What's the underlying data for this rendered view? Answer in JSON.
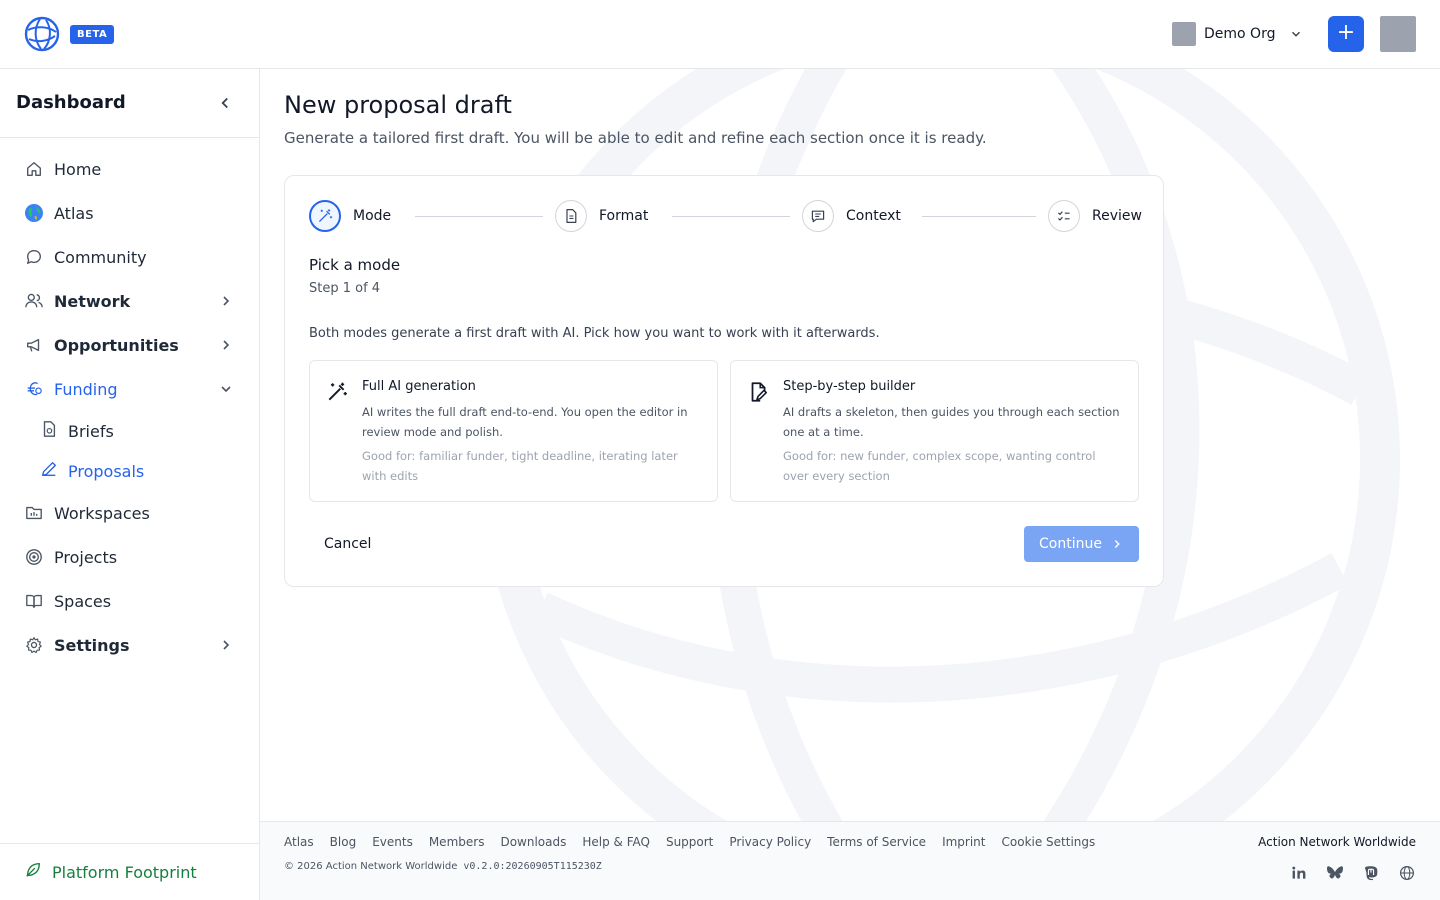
{
  "header": {
    "badge": "BETA",
    "org_name": "Demo Org",
    "add_label": "+"
  },
  "sidebar": {
    "title": "Dashboard",
    "items": [
      {
        "label": "Home"
      },
      {
        "label": "Atlas"
      },
      {
        "label": "Community"
      },
      {
        "label": "Network"
      },
      {
        "label": "Opportunities"
      },
      {
        "label": "Funding"
      },
      {
        "label": "Workspaces"
      },
      {
        "label": "Projects"
      },
      {
        "label": "Spaces"
      },
      {
        "label": "Settings"
      }
    ],
    "funding_children": [
      {
        "label": "Briefs"
      },
      {
        "label": "Proposals"
      }
    ],
    "footer_label": "Platform Footprint"
  },
  "main": {
    "title": "New proposal draft",
    "subtitle": "Generate a tailored first draft. You will be able to edit and refine each section once it is ready.",
    "steps": [
      {
        "label": "Mode"
      },
      {
        "label": "Format"
      },
      {
        "label": "Context"
      },
      {
        "label": "Review"
      }
    ],
    "section_title": "Pick a mode",
    "section_step": "Step 1 of 4",
    "section_desc": "Both modes generate a first draft with AI. Pick how you want to work with it afterwards.",
    "options": [
      {
        "title": "Full AI generation",
        "desc": "AI writes the full draft end-to-end. You open the editor in review mode and polish.",
        "good_label": "Good for:",
        "good_text": "familiar funder, tight deadline, iterating later with edits"
      },
      {
        "title": "Step-by-step builder",
        "desc": "AI drafts a skeleton, then guides you through each section one at a time.",
        "good_label": "Good for:",
        "good_text": "new funder, complex scope, wanting control over every section"
      }
    ],
    "cancel_label": "Cancel",
    "continue_label": "Continue"
  },
  "footer": {
    "links": [
      "Atlas",
      "Blog",
      "Events",
      "Members",
      "Downloads",
      "Help & FAQ",
      "Support",
      "Privacy Policy",
      "Terms of Service",
      "Imprint",
      "Cookie Settings"
    ],
    "copyright": "© 2026 Action Network Worldwide",
    "version": "v0.2.0:20260905T115230Z",
    "org": "Action Network Worldwide"
  },
  "colors": {
    "accent": "#2563eb",
    "continue_disabled": "#7aa5f5",
    "footprint_green": "#15803d"
  }
}
